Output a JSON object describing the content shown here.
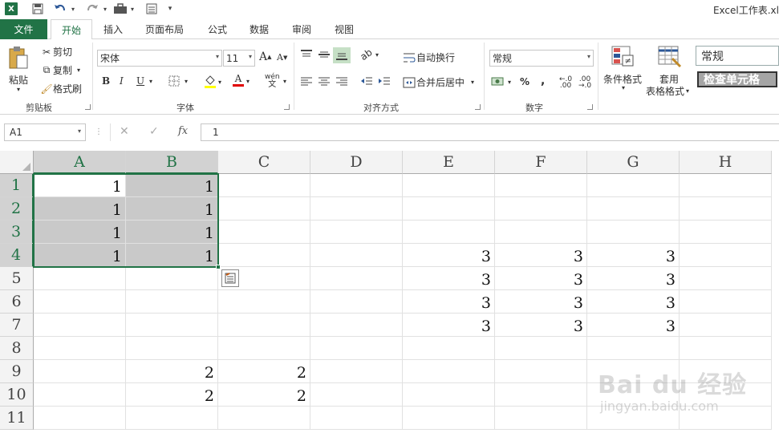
{
  "window": {
    "title": "Excel工作表.xl"
  },
  "quick_access": {
    "app_icon": "X"
  },
  "ribbon_tabs": {
    "file": "文件",
    "items": [
      "开始",
      "插入",
      "页面布局",
      "公式",
      "数据",
      "审阅",
      "视图"
    ]
  },
  "clipboard": {
    "paste": "粘贴",
    "cut": "剪切",
    "copy": "复制",
    "format_painter": "格式刷",
    "label": "剪贴板"
  },
  "font": {
    "name": "宋体",
    "size": "11",
    "grow": "A",
    "shrink": "A",
    "bold": "B",
    "italic": "I",
    "underline": "U",
    "font_color_glyph": "A",
    "phonetic": "wén",
    "label": "字体"
  },
  "alignment": {
    "wrap": "自动换行",
    "merge": "合并后居中",
    "label": "对齐方式"
  },
  "number": {
    "format": "常规",
    "percent": "%",
    "comma": ",",
    "label": "数字"
  },
  "styles": {
    "conditional": "条件格式",
    "table_line1": "套用",
    "table_line2": "表格格式",
    "normal": "常规",
    "check_cell": "检查单元格"
  },
  "formula_bar": {
    "name_box": "A1",
    "cancel": "✕",
    "enter": "✓",
    "fx": "fx",
    "value": "1"
  },
  "grid": {
    "columns": [
      "A",
      "B",
      "C",
      "D",
      "E",
      "F",
      "G",
      "H"
    ],
    "rows": [
      "1",
      "2",
      "3",
      "4",
      "5",
      "6",
      "7",
      "8",
      "9",
      "10",
      "11"
    ],
    "cells": {
      "A1": "1",
      "B1": "1",
      "A2": "1",
      "B2": "1",
      "A3": "1",
      "B3": "1",
      "A4": "1",
      "B4": "1",
      "E4": "3",
      "F4": "3",
      "G4": "3",
      "E5": "3",
      "F5": "3",
      "G5": "3",
      "E6": "3",
      "F6": "3",
      "G6": "3",
      "E7": "3",
      "F7": "3",
      "G7": "3",
      "B9": "2",
      "C9": "2",
      "B10": "2",
      "C10": "2"
    }
  },
  "watermark": {
    "brand": "Bai du 经验",
    "url": "jingyan.baidu.com"
  }
}
